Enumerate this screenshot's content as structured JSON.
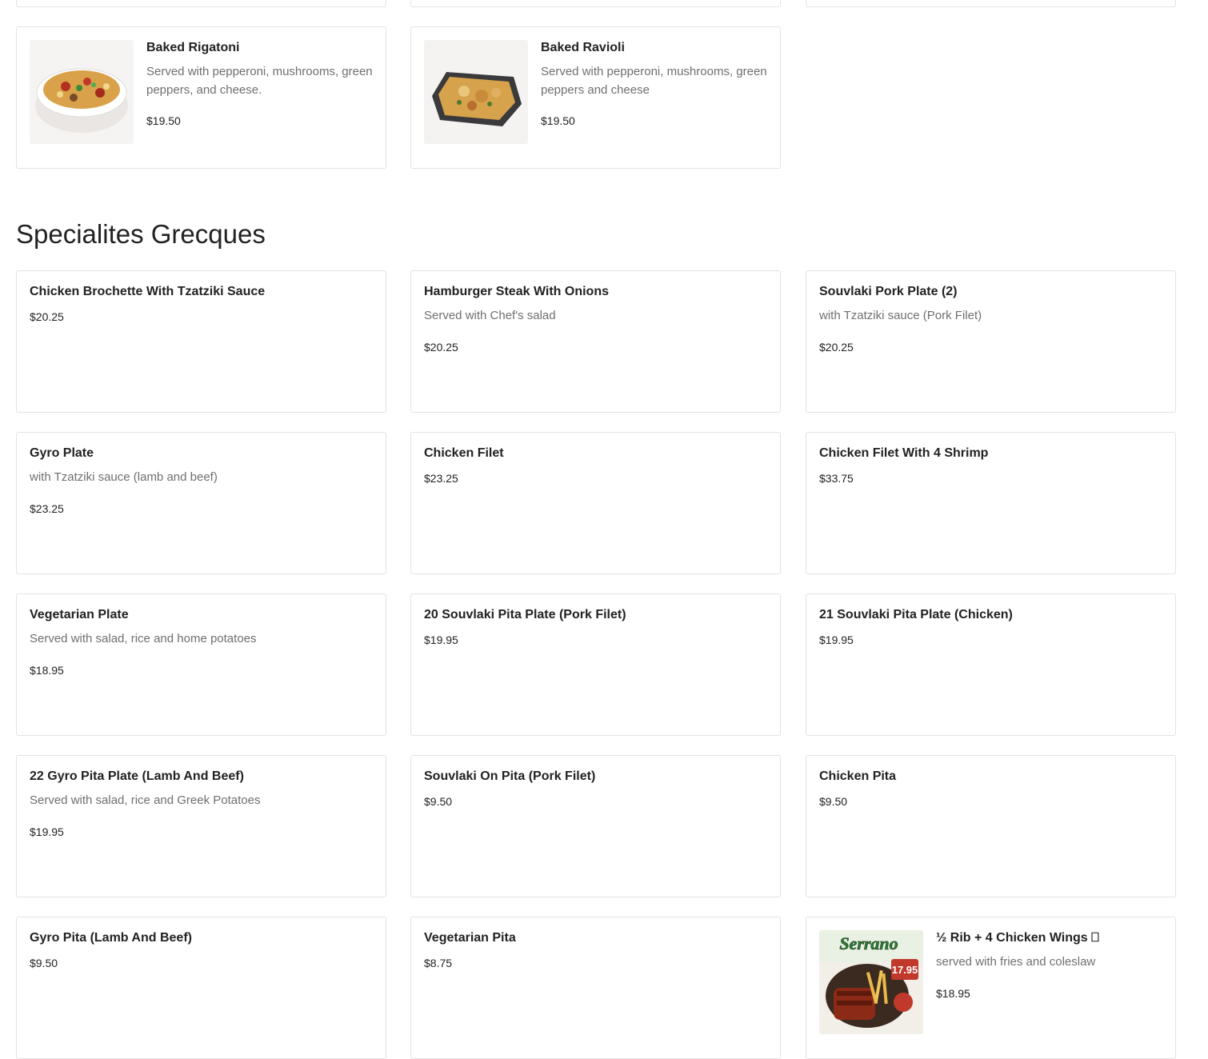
{
  "pasta": [
    {
      "name": "Baked Rigatoni",
      "desc": "Served with pepperoni, mushrooms, green peppers, and cheese.",
      "price": "$19.50",
      "image": "baked-rigatoni-photo"
    },
    {
      "name": "Baked Ravioli",
      "desc": "Served with pepperoni, mushrooms, green peppers and cheese",
      "price": "$19.50",
      "image": "baked-ravioli-photo"
    }
  ],
  "greek_section": {
    "title": "Specialites Grecques",
    "items": [
      {
        "name": "Chicken Brochette With Tzatziki Sauce",
        "desc": "",
        "price": "$20.25"
      },
      {
        "name": "Hamburger Steak With Onions",
        "desc": "Served with Chef's salad",
        "price": "$20.25"
      },
      {
        "name": "Souvlaki Pork Plate (2)",
        "desc": "with Tzatziki sauce (Pork Filet)",
        "price": "$20.25"
      },
      {
        "name": "Gyro Plate",
        "desc": "with Tzatziki sauce (lamb and beef)",
        "price": "$23.25"
      },
      {
        "name": "Chicken Filet",
        "desc": "",
        "price": "$23.25"
      },
      {
        "name": "Chicken Filet With 4 Shrimp",
        "desc": "",
        "price": "$33.75"
      },
      {
        "name": "Vegetarian Plate",
        "desc": "Served with salad, rice and home potatoes",
        "price": "$18.95"
      },
      {
        "name": "20 Souvlaki Pita Plate (Pork Filet)",
        "desc": "",
        "price": "$19.95"
      },
      {
        "name": "21 Souvlaki Pita Plate (Chicken)",
        "desc": "",
        "price": "$19.95"
      },
      {
        "name": "22 Gyro Pita Plate (Lamb And Beef)",
        "desc": "Served with salad, rice and Greek Potatoes",
        "price": "$19.95"
      },
      {
        "name": "Souvlaki On Pita (Pork Filet)",
        "desc": "",
        "price": "$9.50"
      },
      {
        "name": "Chicken Pita",
        "desc": "",
        "price": "$9.50"
      },
      {
        "name": "Gyro Pita (Lamb And Beef)",
        "desc": "",
        "price": "$9.50"
      },
      {
        "name": "Vegetarian Pita",
        "desc": "",
        "price": "$8.75"
      },
      {
        "name": "½ Rib + 4 Chicken Wings ⎕",
        "desc": "served with fries and coleslaw",
        "price": "$18.95",
        "image": "rib-wings-promo-photo",
        "promo_text": "Serrano",
        "promo_price": "17.95"
      }
    ]
  }
}
